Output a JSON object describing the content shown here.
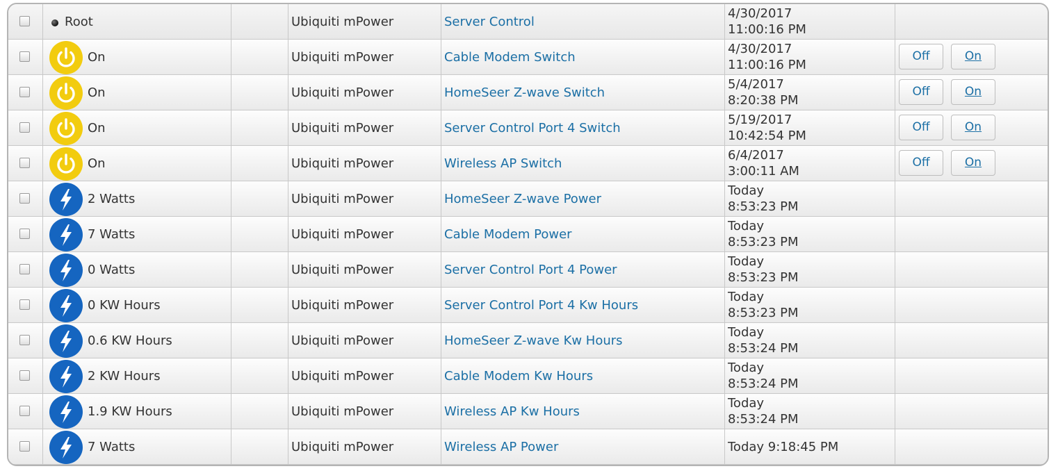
{
  "colors": {
    "switch_icon": "#f2cc0f",
    "power_icon": "#1565c0",
    "link": "#1b6fa5",
    "text": "#333333"
  },
  "rows": [
    {
      "status": "Root",
      "icon": "root-dot",
      "interface": "Ubiquiti mPower",
      "name": "Server Control",
      "date1": "4/30/2017",
      "date2": "11:00:16 PM",
      "buttons": []
    },
    {
      "status": "On",
      "icon": "power-switch-icon",
      "interface": "Ubiquiti mPower",
      "name": "Cable Modem Switch",
      "date1": "4/30/2017",
      "date2": "11:00:16 PM",
      "buttons": [
        "Off",
        "On"
      ]
    },
    {
      "status": "On",
      "icon": "power-switch-icon",
      "interface": "Ubiquiti mPower",
      "name": "HomeSeer Z-wave Switch",
      "date1": "5/4/2017",
      "date2": "8:20:38 PM",
      "buttons": [
        "Off",
        "On"
      ]
    },
    {
      "status": "On",
      "icon": "power-switch-icon",
      "interface": "Ubiquiti mPower",
      "name": "Server Control Port 4 Switch",
      "date1": "5/19/2017",
      "date2": "10:42:54 PM",
      "buttons": [
        "Off",
        "On"
      ]
    },
    {
      "status": "On",
      "icon": "power-switch-icon",
      "interface": "Ubiquiti mPower",
      "name": "Wireless AP Switch",
      "date1": "6/4/2017",
      "date2": "3:00:11 AM",
      "buttons": [
        "Off",
        "On"
      ]
    },
    {
      "status": "2 Watts",
      "icon": "lightning-icon",
      "interface": "Ubiquiti mPower",
      "name": "HomeSeer Z-wave Power",
      "date1": "Today",
      "date2": "8:53:23 PM",
      "buttons": []
    },
    {
      "status": "7 Watts",
      "icon": "lightning-icon",
      "interface": "Ubiquiti mPower",
      "name": "Cable Modem Power",
      "date1": "Today",
      "date2": "8:53:23 PM",
      "buttons": []
    },
    {
      "status": "0 Watts",
      "icon": "lightning-icon",
      "interface": "Ubiquiti mPower",
      "name": "Server Control Port 4 Power",
      "date1": "Today",
      "date2": "8:53:23 PM",
      "buttons": []
    },
    {
      "status": "0 KW Hours",
      "icon": "lightning-icon",
      "interface": "Ubiquiti mPower",
      "name": "Server Control Port 4 Kw Hours",
      "date1": "Today",
      "date2": "8:53:23 PM",
      "buttons": []
    },
    {
      "status": "0.6 KW Hours",
      "icon": "lightning-icon",
      "interface": "Ubiquiti mPower",
      "name": "HomeSeer Z-wave Kw Hours",
      "date1": "Today",
      "date2": "8:53:24 PM",
      "buttons": []
    },
    {
      "status": "2 KW Hours",
      "icon": "lightning-icon",
      "interface": "Ubiquiti mPower",
      "name": "Cable Modem Kw Hours",
      "date1": "Today",
      "date2": "8:53:24 PM",
      "buttons": []
    },
    {
      "status": "1.9 KW Hours",
      "icon": "lightning-icon",
      "interface": "Ubiquiti mPower",
      "name": "Wireless AP Kw Hours",
      "date1": "Today",
      "date2": "8:53:24 PM",
      "buttons": []
    },
    {
      "status": "7 Watts",
      "icon": "lightning-icon",
      "interface": "Ubiquiti mPower",
      "name": "Wireless AP Power",
      "date1": "Today 9:18:45 PM",
      "date2": "",
      "buttons": []
    }
  ]
}
